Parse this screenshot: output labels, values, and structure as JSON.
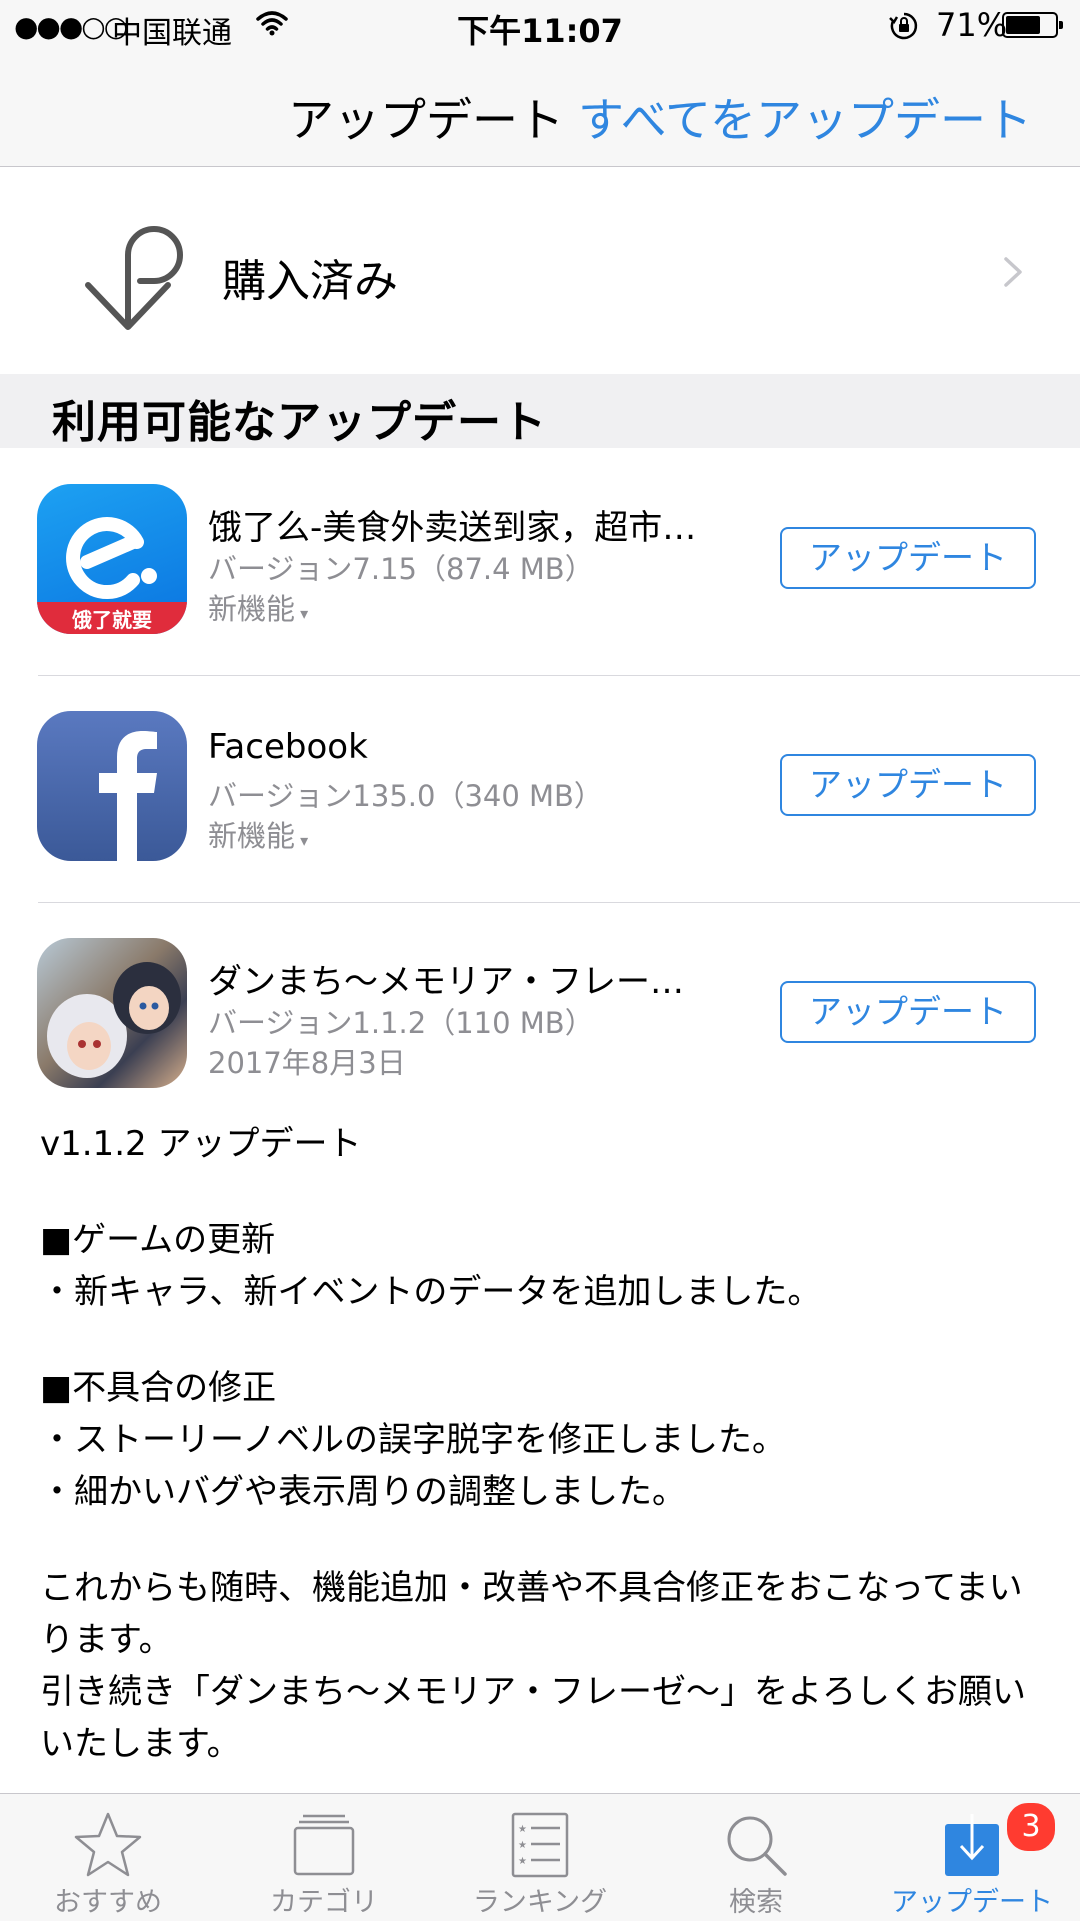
{
  "status_bar": {
    "signal": "●●●○○",
    "carrier": "中国联通",
    "time": "下午11:07",
    "battery_percent": "71%",
    "battery_level": 0.71
  },
  "navbar": {
    "title": "アップデート",
    "update_all": "すべてをアップデート"
  },
  "purchased": {
    "label": "購入済み"
  },
  "section": {
    "title": "利用可能なアップデート"
  },
  "apps": [
    {
      "name": "饿了么-美食外卖送到家，超市…",
      "version": "バージョン7.15（87.4 MB）",
      "sub": "新機能",
      "button": "アップデート",
      "icon_caption": "饿了就要"
    },
    {
      "name": "Facebook",
      "version": "バージョン135.0（340 MB）",
      "sub": "新機能",
      "button": "アップデート"
    },
    {
      "name": "ダンまち～メモリア・フレー…",
      "version": "バージョン1.1.2（110 MB）",
      "sub": "2017年8月3日",
      "button": "アップデート"
    }
  ],
  "release_notes": {
    "heading": "v1.1.2 アップデート",
    "s1_title": "■ゲームの更新",
    "s1_l1": "・新キャラ、新イベントのデータを追加しました。",
    "s2_title": "■不具合の修正",
    "s2_l1": "・ストーリーノベルの誤字脱字を修正しました。",
    "s2_l2": "・細かいバグや表示周りの調整しました。",
    "p1": "これからも随時、機能追加・改善や不具合修正をおこなってまいります。",
    "p2": "引き続き「ダンまち～メモリア・フレーゼ～」をよろしくお願いいたします。"
  },
  "tabs": [
    {
      "label": "おすすめ",
      "icon": "star-icon"
    },
    {
      "label": "カテゴリ",
      "icon": "categories-icon"
    },
    {
      "label": "ランキング",
      "icon": "ranking-list-icon"
    },
    {
      "label": "検索",
      "icon": "search-icon"
    },
    {
      "label": "アップデート",
      "icon": "updates-icon",
      "badge": "3",
      "active": true
    }
  ],
  "colors": {
    "accent": "#2f86e0",
    "badge": "#ff3b30",
    "secondary_text": "#8e8e93"
  }
}
